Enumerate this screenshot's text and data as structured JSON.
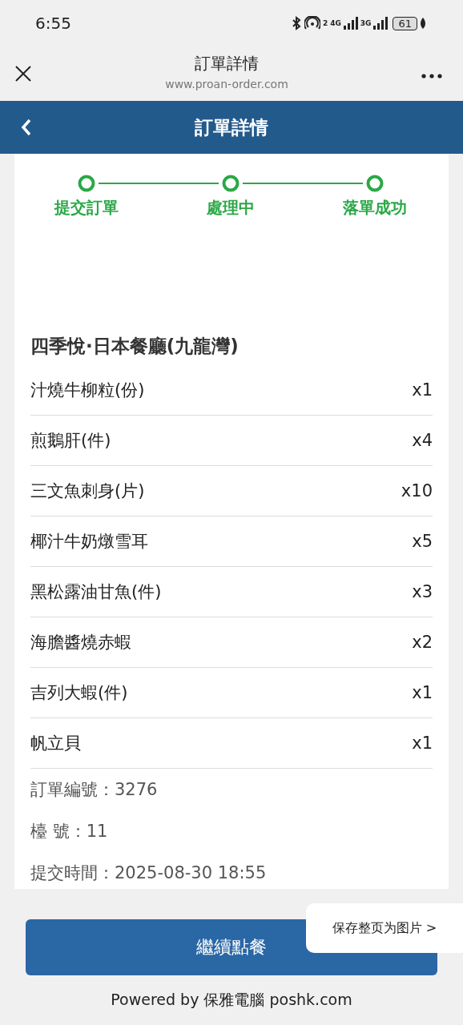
{
  "status_bar": {
    "time": "6:55",
    "network_sup": "2",
    "network_1": "4G",
    "network_2": "3G",
    "battery": "61"
  },
  "browser_bar": {
    "title": "訂單詳情",
    "url": "www.proan-order.com"
  },
  "header": {
    "title": "訂單詳情"
  },
  "steps": [
    {
      "label": "提交訂單",
      "done": true
    },
    {
      "label": "處理中",
      "done": true
    },
    {
      "label": "落單成功",
      "done": true
    }
  ],
  "restaurant": "四季悅·日本餐廳(九龍灣)",
  "items": [
    {
      "name": "汁燒牛柳粒(份)",
      "qty": "x1"
    },
    {
      "name": "煎鵝肝(件)",
      "qty": "x4"
    },
    {
      "name": "三文魚刺身(片)",
      "qty": "x10"
    },
    {
      "name": "椰汁牛奶燉雪耳",
      "qty": "x5"
    },
    {
      "name": "黑松露油甘魚(件)",
      "qty": "x3"
    },
    {
      "name": "海膽醬燒赤蝦",
      "qty": "x2"
    },
    {
      "name": "吉列大蝦(件)",
      "qty": "x1"
    },
    {
      "name": "帆立貝",
      "qty": "x1"
    }
  ],
  "info": [
    "訂單編號：3276",
    "檯 號：11",
    "提交時間：2025-08-30 18:55"
  ],
  "continue_button": "繼續點餐",
  "footer": "Powered by 保雅電腦 poshk.com",
  "save_toast": "保存整页为图片 >"
}
